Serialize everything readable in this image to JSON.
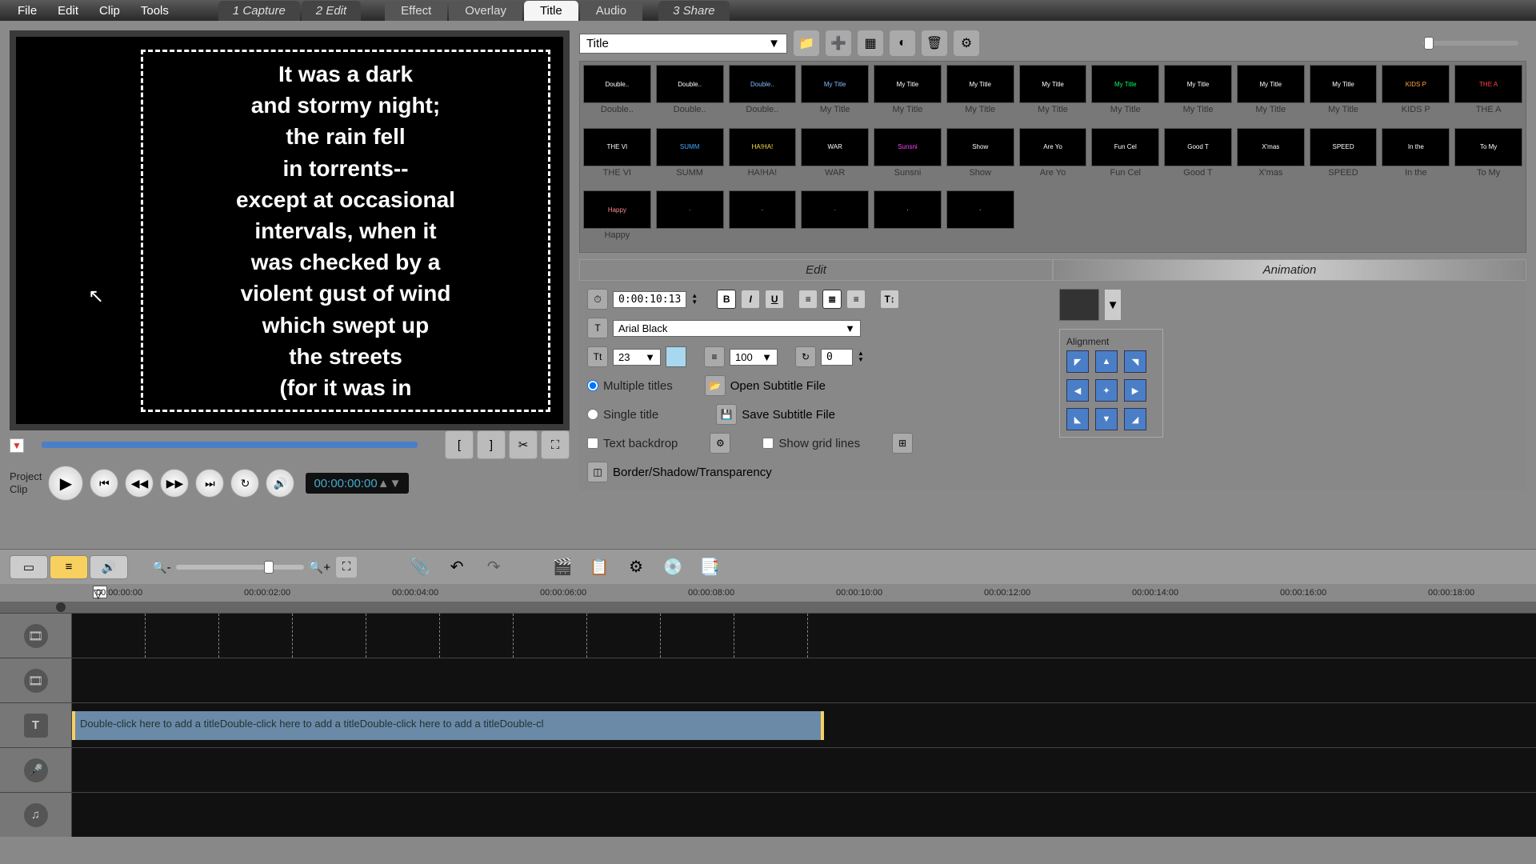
{
  "menu": {
    "file": "File",
    "edit": "Edit",
    "clip": "Clip",
    "tools": "Tools"
  },
  "steps": {
    "capture": "Capture",
    "edit": "Edit",
    "share": "Share",
    "n1": "1",
    "n2": "2",
    "n3": "3"
  },
  "subtabs": {
    "effect": "Effect",
    "overlay": "Overlay",
    "title": "Title",
    "audio": "Audio"
  },
  "preview_text": "It was  a dark\nand stormy night;\nthe rain fell\nin torrents--\nexcept at occasional\nintervals, when it\nwas checked by a\nviolent gust of wind\nwhich swept up\nthe streets\n(for it was in",
  "proj_labels": {
    "project": "Project",
    "clip": "Clip"
  },
  "timecode": "00:00:00:00",
  "library_dropdown": "Title",
  "titles": [
    {
      "l": "Double..",
      "c": "#fff"
    },
    {
      "l": "Double..",
      "c": "#fff"
    },
    {
      "l": "Double..",
      "c": "#8bf"
    },
    {
      "l": "My Title",
      "c": "#8bf"
    },
    {
      "l": "My Title",
      "c": "#fff"
    },
    {
      "l": "My Title",
      "c": "#fff"
    },
    {
      "l": "My Title",
      "c": "#fff"
    },
    {
      "l": "My Title",
      "c": "#0f6"
    },
    {
      "l": "My Title",
      "c": "#fff"
    },
    {
      "l": "My Title",
      "c": "#fff"
    },
    {
      "l": "My Title",
      "c": "#fff"
    },
    {
      "l": "KIDS P",
      "c": "#fa4"
    },
    {
      "l": "THE A",
      "c": "#f44"
    },
    {
      "l": "THE VI",
      "c": "#fff"
    },
    {
      "l": "SUMM",
      "c": "#4af"
    },
    {
      "l": "HA!HA!",
      "c": "#fd4"
    },
    {
      "l": "WAR",
      "c": "#fff"
    },
    {
      "l": "Sunsni",
      "c": "#f4f"
    },
    {
      "l": "Show",
      "c": "#fff"
    },
    {
      "l": "Are Yo",
      "c": "#fff"
    },
    {
      "l": "Fun Cel",
      "c": "#fff"
    },
    {
      "l": "Good T",
      "c": "#fff"
    },
    {
      "l": "X'mas",
      "c": "#fff"
    },
    {
      "l": "SPEED",
      "c": "#fff"
    },
    {
      "l": "In the",
      "c": "#fff"
    },
    {
      "l": "To My",
      "c": "#fff"
    },
    {
      "l": "Happy",
      "c": "#f88"
    },
    {
      "l": "",
      "c": "#fa4"
    },
    {
      "l": "",
      "c": "#fff"
    },
    {
      "l": "",
      "c": "#f84"
    },
    {
      "l": "",
      "c": "#fff"
    },
    {
      "l": "",
      "c": "#fff"
    }
  ],
  "edit_tabs": {
    "edit": "Edit",
    "animation": "Animation"
  },
  "edit_panel": {
    "duration": "0:00:10:13",
    "font": "Arial Black",
    "size": "23",
    "line_spacing": "100",
    "rotation": "0",
    "multiple": "Multiple titles",
    "single": "Single title",
    "backdrop": "Text backdrop",
    "border": "Border/Shadow/Transparency",
    "open_sub": "Open Subtitle File",
    "save_sub": "Save Subtitle File",
    "grid": "Show grid lines",
    "alignment": "Alignment"
  },
  "ruler_marks": [
    "00:00:00:00",
    "00:00:02:00",
    "00:00:04:00",
    "00:00:06:00",
    "00:00:08:00",
    "00:00:10:00",
    "00:00:12:00",
    "00:00:14:00",
    "00:00:16:00",
    "00:00:18:00"
  ],
  "title_clip_text": "Double-click here to add a titleDouble-click here to add a titleDouble-click here to add a titleDouble-cl"
}
